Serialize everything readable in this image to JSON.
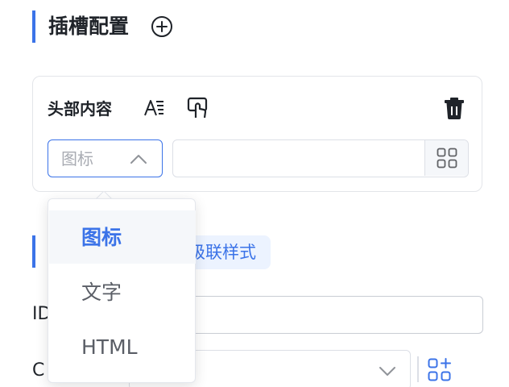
{
  "slot_config": {
    "title": "插槽配置",
    "add_icon": "plus-circle-icon"
  },
  "header_slot": {
    "title": "头部内容",
    "text_style_icon": "text-format-icon",
    "touch_icon": "touch-click-icon",
    "delete_icon": "trash-icon",
    "type_select": {
      "value": "图标",
      "arrow_icon": "chevron-up-icon"
    },
    "icon_input": {
      "value": "",
      "picker_icon": "grid-apps-icon"
    }
  },
  "style_section": {
    "cascade_tab_label": "级联样式"
  },
  "form": {
    "id_label": "ID",
    "id_value": "",
    "class_label": "C",
    "class_value": "",
    "class_arrow_icon": "chevron-down-icon",
    "add_class_icon": "grid-add-icon"
  },
  "type_dropdown": {
    "options": [
      {
        "label": "图标",
        "selected": true
      },
      {
        "label": "文字",
        "selected": false
      },
      {
        "label": "HTML",
        "selected": false
      }
    ]
  },
  "colors": {
    "accent": "#3b73e8",
    "border": "#dcdfe6",
    "placeholder": "#a8abb2",
    "text": "#1f2329"
  }
}
